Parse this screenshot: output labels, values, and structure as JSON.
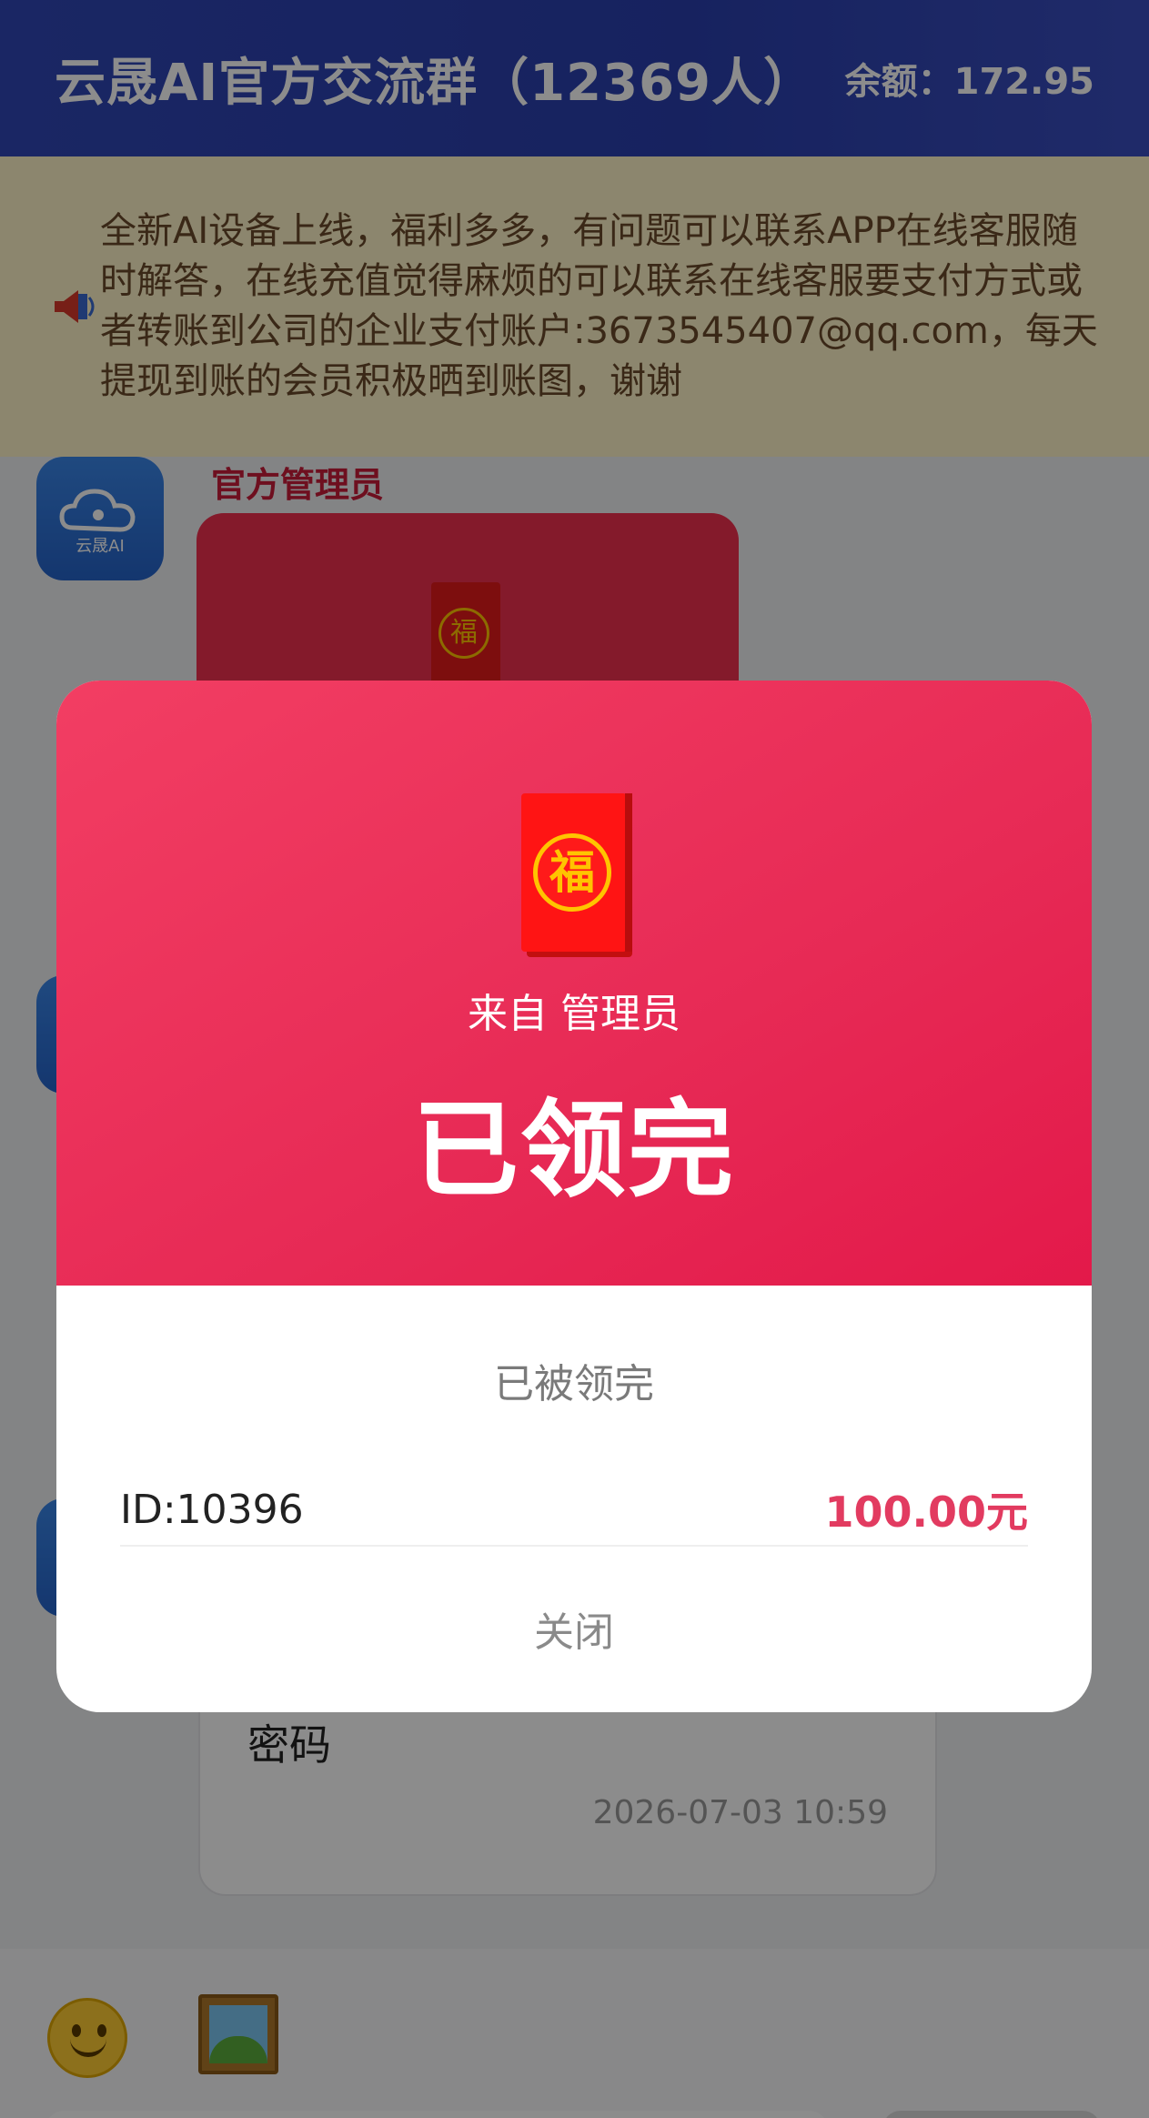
{
  "header": {
    "title": "云晟AI官方交流群（12369人）",
    "balance": "余额：172.95"
  },
  "notice": {
    "icon": "speaker-icon",
    "text": "全新AI设备上线，福利多多，有问题可以联系APP在线客服随时解答，在线充值觉得麻烦的可以联系在线客服要支付方式或者转账到公司的企业支付账户:3673545407@qq.com，每天提现到账的会员积极晒到账图，谢谢"
  },
  "chat": {
    "avatar_label": "云晟AI",
    "sender": "官方管理员",
    "message": "密码",
    "time": "2026-07-03 10:59"
  },
  "modal": {
    "fu": "福",
    "from": "来自 管理员",
    "status": "已领完",
    "sub_status": "已被领完",
    "record_id": "ID:10396",
    "record_amount": "100.00元",
    "close": "关闭"
  },
  "colors": {
    "header": "#2a3fae",
    "accent_red": "#e72a55",
    "amount": "#e23b60"
  }
}
